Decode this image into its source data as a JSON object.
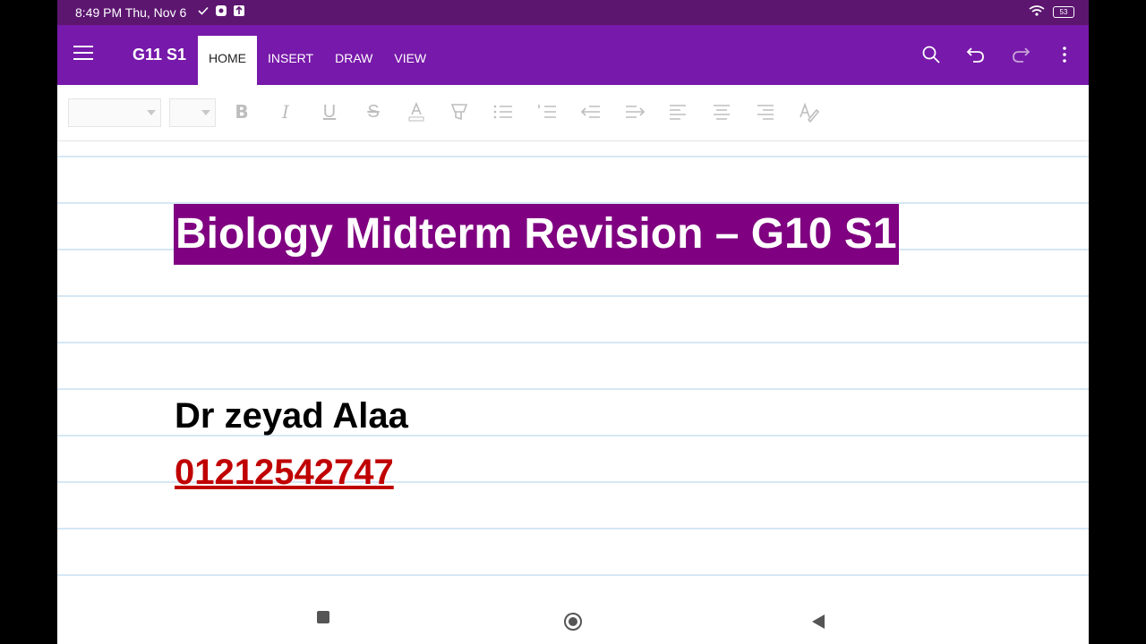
{
  "status_bar": {
    "time": "8:49 PM Thu, Nov 6",
    "battery": "53"
  },
  "app_bar": {
    "notebook_name": "G11 S1",
    "tabs": [
      {
        "label": "HOME",
        "active": true
      },
      {
        "label": "INSERT",
        "active": false
      },
      {
        "label": "DRAW",
        "active": false
      },
      {
        "label": "VIEW",
        "active": false
      }
    ],
    "actions": [
      "search-icon",
      "undo-icon",
      "redo-icon",
      "more-vert-icon"
    ]
  },
  "toolbar": {
    "font_family": "",
    "font_size": "",
    "buttons": [
      "bold-icon",
      "italic-icon",
      "underline-icon",
      "strikethrough-icon",
      "font-color-icon",
      "highlight-icon",
      "bullet-list-icon",
      "numbered-list-icon",
      "decrease-indent-icon",
      "increase-indent-icon",
      "align-left-icon",
      "align-center-icon",
      "align-right-icon",
      "clear-format-icon"
    ]
  },
  "page": {
    "title": "Biology Midterm Revision – G10 S1",
    "title_highlight_color": "#7f0080",
    "author": "Dr zeyad Alaa",
    "phone": "01212542747",
    "phone_color": "#c00000"
  },
  "colors": {
    "app_bar": "#7719aa",
    "status_bar": "#5c1670"
  }
}
